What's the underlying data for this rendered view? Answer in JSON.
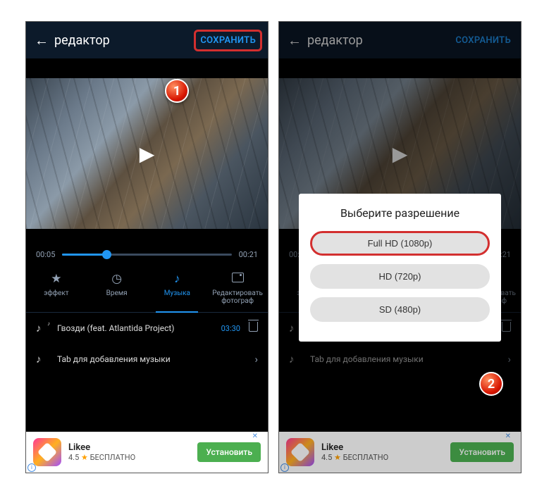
{
  "header": {
    "title": "редактор",
    "save": "СОХРАНИТЬ"
  },
  "timeline": {
    "start": "00:05",
    "end": "00:21",
    "progress_pct": 26
  },
  "tabs": [
    {
      "label": "эффект",
      "icon": "★"
    },
    {
      "label": "Время",
      "icon": "◷"
    },
    {
      "label": "Музыка",
      "icon": "♪",
      "active": true
    },
    {
      "label": "Редактировать фотограф",
      "icon": "img"
    }
  ],
  "tracks": [
    {
      "name": "Гвозди (feat. Atlantida Project)",
      "duration": "03:30"
    }
  ],
  "add_hint": "Tab для добавления музыки",
  "dialog": {
    "title": "Выберите разрешение",
    "options": [
      "Full HD (1080p)",
      "HD (720p)",
      "SD (480p)"
    ]
  },
  "ad": {
    "title": "Likee",
    "rating": "4.5",
    "tag": "БЕСПЛАТНО",
    "cta": "Установить"
  },
  "markers": {
    "1": "1",
    "2": "2"
  }
}
